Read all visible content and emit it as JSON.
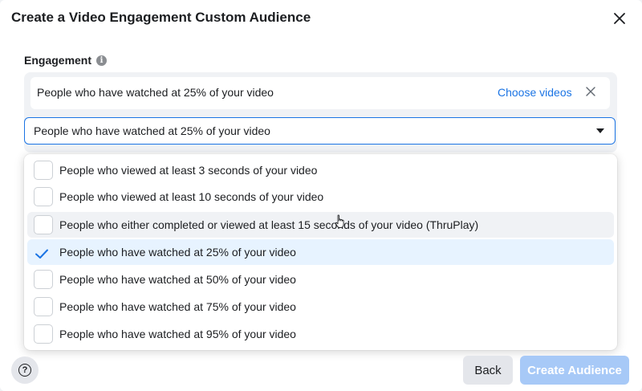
{
  "dialog": {
    "title": "Create a Video Engagement Custom Audience",
    "close_icon": "close-icon"
  },
  "engagement": {
    "label": "Engagement",
    "info_icon": "info-icon",
    "rule": {
      "text": "People who have watched at 25% of your video",
      "choose_videos": "Choose videos",
      "remove_icon": "close-icon"
    },
    "select": {
      "value": "People who have watched at 25% of your video"
    }
  },
  "dropdown": {
    "options": [
      {
        "label": "People who viewed at least 3 seconds of your video",
        "checked": false
      },
      {
        "label": "People who viewed at least 10 seconds of your video",
        "checked": false
      },
      {
        "label": "People who either completed or viewed at least 15 seconds of your video (ThruPlay)",
        "checked": false,
        "hovered": true
      },
      {
        "label": "People who have watched at 25% of your video",
        "checked": true
      },
      {
        "label": "People who have watched at 50% of your video",
        "checked": false
      },
      {
        "label": "People who have watched at 75% of your video",
        "checked": false
      },
      {
        "label": "People who have watched at 95% of your video",
        "checked": false
      }
    ]
  },
  "footer": {
    "help_icon": "help-icon",
    "back_label": "Back",
    "create_label": "Create Audience"
  },
  "colors": {
    "accent": "#1b74e4",
    "selected_bg": "#e7f3ff",
    "disabled_primary": "#a7c9f7"
  }
}
